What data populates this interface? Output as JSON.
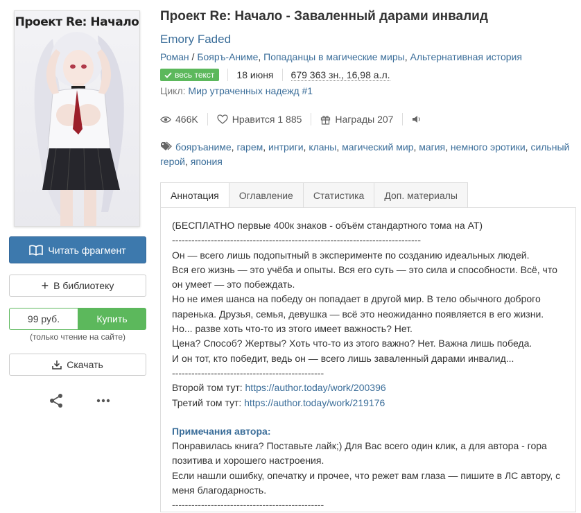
{
  "book": {
    "cover_title": "Проект Re: Начало",
    "title": "Проект Re: Начало - Заваленный дарами инвалид",
    "author": "Emory Faded",
    "genres": [
      "Роман",
      "Бояръ-Аниме",
      "Попаданцы в магические миры",
      "Альтернативная история"
    ],
    "status_badge": "весь текст",
    "date": "18 июня",
    "size": "679 363 зн., 16,98 а.л.",
    "cycle_label": "Цикл:",
    "cycle_name": "Мир утраченных надежд #1"
  },
  "stats": {
    "views": "466K",
    "likes": "Нравится 1 885",
    "awards": "Награды 207"
  },
  "tags": [
    "бояръаниме",
    "гарем",
    "интриги",
    "кланы",
    "магический мир",
    "магия",
    "немного эротики",
    "сильный герой",
    "япония"
  ],
  "tabs": [
    "Аннотация",
    "Оглавление",
    "Статистика",
    "Доп. материалы"
  ],
  "sidebar": {
    "read_label": "Читать фрагмент",
    "library_label": "В библиотеку",
    "price": "99 руб.",
    "buy_label": "Купить",
    "only_site": "(только чтение на сайте)",
    "download_label": "Скачать"
  },
  "annotation": {
    "lines": [
      "(БЕСПЛАТНО первые 400к знаков - объём стандартного тома на АТ)",
      "-----------------------------------------------------------------------------",
      "Он — всего лишь подопытный в эксперименте по созданию идеальных людей.",
      "Вся его жизнь — это учёба и опыты. Вся его суть — это сила и способности. Всё, что",
      "он умеет — это побеждать.",
      "Но не имея шанса на победу он попадает в другой мир. В тело обычного доброго",
      "паренька. Друзья, семья, девушка — всё это неожиданно появляется в его жизни.",
      "Но... разве хоть что-то из этого имеет важность? Нет.",
      "Цена? Способ? Жертвы? Хоть что-то из этого важно? Нет. Важна лишь победа.",
      "И он тот, кто победит, ведь он — всего лишь заваленный дарами инвалид...",
      "-----------------------------------------------"
    ],
    "vol2_label": "Второй том тут: ",
    "vol2_link": "https://author.today/work/200396",
    "vol3_label": "Третий том тут: ",
    "vol3_link": "https://author.today/work/219176",
    "notes_title": "Примечания автора:",
    "notes_lines": [
      "Понравилась книга? Поставьте лайк;) Для Вас всего один клик, а для автора - гора",
      "позитива и хорошего настроения.",
      "Если нашли ошибку, опечатку и прочее, что режет вам глаза — пишите в ЛС автору, с",
      "меня благодарность.",
      "-----------------------------------------------"
    ]
  },
  "colors": {
    "link": "#3a6d99",
    "read_button": "#3d79ad",
    "buy_green": "#5cb85c"
  }
}
